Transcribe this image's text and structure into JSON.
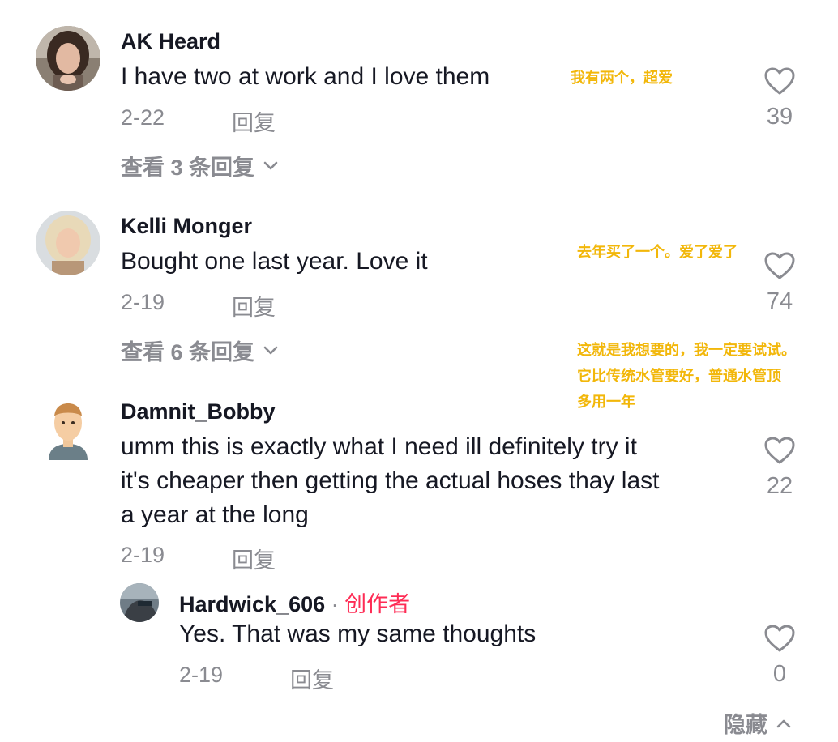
{
  "comments": [
    {
      "username": "AK Heard",
      "text": "I have two at work and I love them",
      "date": "2-22",
      "reply_label": "回复",
      "likes": "39",
      "view_replies": "查看 3 条回复",
      "annotation": "我有两个，超爱"
    },
    {
      "username": "Kelli Monger",
      "text": "Bought one last year. Love it",
      "date": "2-19",
      "reply_label": "回复",
      "likes": "74",
      "view_replies": "查看 6 条回复",
      "annotation": "去年买了一个。爱了爱了"
    },
    {
      "username": "Damnit_Bobby",
      "text_lines": [
        "umm this is exactly what I need ill definitely try it",
        "it's cheaper then getting the actual hoses thay last",
        "a year at the long"
      ],
      "date": "2-19",
      "reply_label": "回复",
      "likes": "22",
      "annotation_lines": [
        "这就是我想要的，我一定要试试。",
        "它比传统水管要好，普通水管顶",
        "多用一年"
      ]
    }
  ],
  "reply": {
    "username": "Hardwick_606",
    "separator": "·",
    "creator_badge": "创作者",
    "text": "Yes. That was my same thoughts",
    "date": "2-19",
    "reply_label": "回复",
    "likes": "0"
  },
  "hide_label": "隐藏",
  "colors": {
    "accent": "#fe2c55",
    "annotation": "#f2b70a",
    "meta": "#8a8b91"
  }
}
